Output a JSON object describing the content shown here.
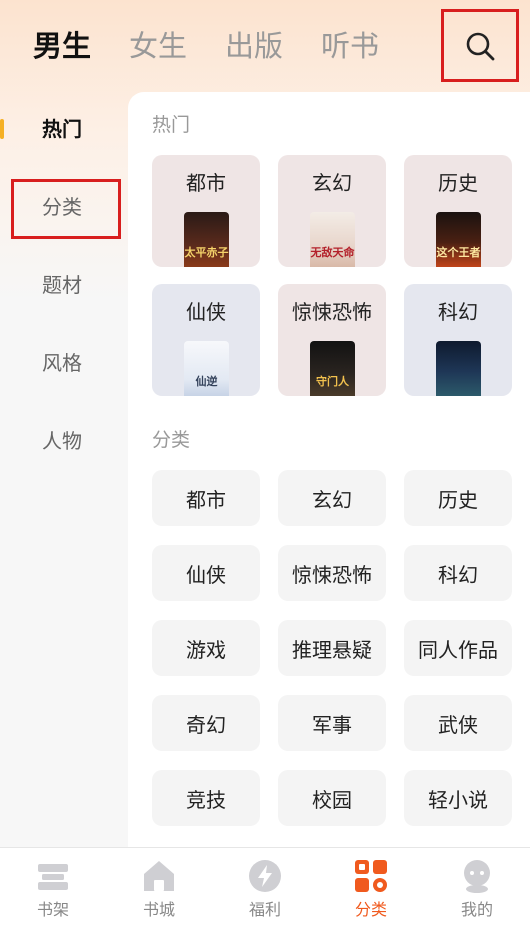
{
  "header": {
    "tabs": [
      {
        "label": "男生",
        "active": true
      },
      {
        "label": "女生",
        "active": false
      },
      {
        "label": "出版",
        "active": false
      },
      {
        "label": "听书",
        "active": false
      }
    ],
    "search_icon": "search-icon"
  },
  "sidebar": {
    "items": [
      {
        "label": "热门",
        "active": true
      },
      {
        "label": "分类",
        "active": false
      },
      {
        "label": "题材",
        "active": false
      },
      {
        "label": "风格",
        "active": false
      },
      {
        "label": "人物",
        "active": false
      }
    ],
    "indicator_color": "#f5b024"
  },
  "hot": {
    "title": "热门",
    "cards": [
      {
        "label": "都市",
        "cover_text": "太平赤子"
      },
      {
        "label": "玄幻",
        "cover_text": "无敌天命"
      },
      {
        "label": "历史",
        "cover_text": "这个王者"
      },
      {
        "label": "仙侠",
        "cover_text": "仙逆"
      },
      {
        "label": "惊悚恐怖",
        "cover_text": "守门人"
      },
      {
        "label": "科幻",
        "cover_text": ""
      }
    ]
  },
  "category": {
    "title": "分类",
    "items": [
      "都市",
      "玄幻",
      "历史",
      "仙侠",
      "惊悚恐怖",
      "科幻",
      "游戏",
      "推理悬疑",
      "同人作品",
      "奇幻",
      "军事",
      "武侠",
      "竞技",
      "校园",
      "轻小说"
    ]
  },
  "bottom_nav": {
    "items": [
      {
        "label": "书架",
        "icon": "bookshelf-icon",
        "active": false
      },
      {
        "label": "书城",
        "icon": "home-icon",
        "active": false
      },
      {
        "label": "福利",
        "icon": "lightning-icon",
        "active": false
      },
      {
        "label": "分类",
        "icon": "category-grid-icon",
        "active": true
      },
      {
        "label": "我的",
        "icon": "profile-icon",
        "active": false
      }
    ],
    "active_color": "#f05a1e"
  }
}
